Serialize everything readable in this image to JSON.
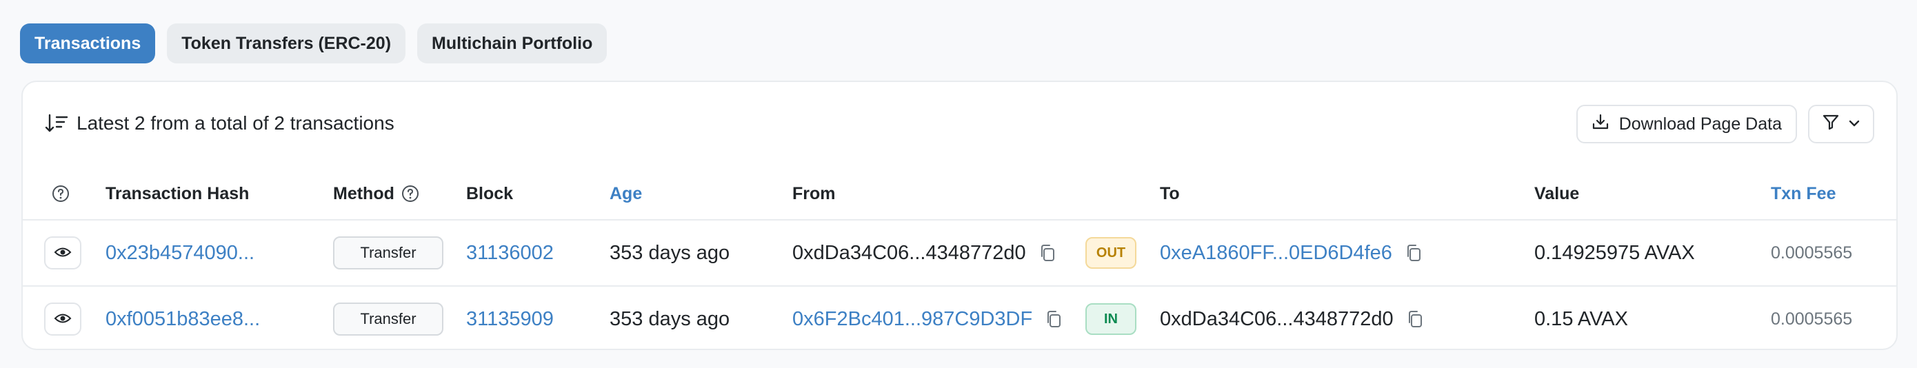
{
  "tabs": [
    {
      "label": "Transactions",
      "active": true
    },
    {
      "label": "Token Transfers (ERC-20)",
      "active": false
    },
    {
      "label": "Multichain Portfolio",
      "active": false
    }
  ],
  "summary": {
    "text": "Latest 2 from a total of 2 transactions",
    "icon": "sort-icon"
  },
  "actions": {
    "download_label": "Download Page Data",
    "download_icon": "download-icon",
    "filter_icon": "filter-icon"
  },
  "columns": {
    "hash": "Transaction Hash",
    "method": "Method",
    "block": "Block",
    "age": "Age",
    "from": "From",
    "to": "To",
    "value": "Value",
    "fee": "Txn Fee"
  },
  "rows": [
    {
      "hash": "0x23b4574090...",
      "method": "Transfer",
      "block": "31136002",
      "age": "353 days ago",
      "from": "0xdDa34C06...4348772d0",
      "direction": "OUT",
      "to": "0xeA1860FF...0ED6D4fe6",
      "value": "0.14925975 AVAX",
      "fee": "0.0005565"
    },
    {
      "hash": "0xf0051b83ee8...",
      "method": "Transfer",
      "block": "31135909",
      "age": "353 days ago",
      "from": "0x6F2Bc401...987C9D3DF",
      "direction": "IN",
      "to": "0xdDa34C06...4348772d0",
      "value": "0.15 AVAX",
      "fee": "0.0005565"
    }
  ],
  "colors": {
    "accent": "#3d80c4",
    "out_badge": "#b78103",
    "in_badge": "#0b8a51"
  }
}
